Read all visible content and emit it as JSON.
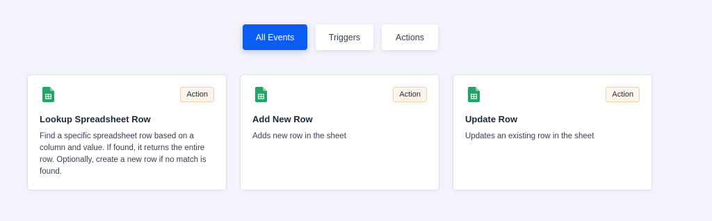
{
  "tabs": [
    {
      "label": "All Events",
      "active": true
    },
    {
      "label": "Triggers",
      "active": false
    },
    {
      "label": "Actions",
      "active": false
    }
  ],
  "cards": [
    {
      "icon": "google-sheets-icon",
      "badge": "Action",
      "title": "Lookup Spreadsheet Row",
      "description": "Find a specific spreadsheet row based on a column and value. If found, it returns the entire row. Optionally, create a new row if no match is found."
    },
    {
      "icon": "google-sheets-icon",
      "badge": "Action",
      "title": "Add New Row",
      "description": "Adds new row in the sheet"
    },
    {
      "icon": "google-sheets-icon",
      "badge": "Action",
      "title": "Update Row",
      "description": "Updates an existing row in the sheet"
    }
  ],
  "colors": {
    "page_background": "#f2f3fb",
    "accent": "#0b5cf5",
    "badge_background": "#fff5ea",
    "badge_border": "#f6cfa6",
    "sheets_green": "#23a566"
  }
}
